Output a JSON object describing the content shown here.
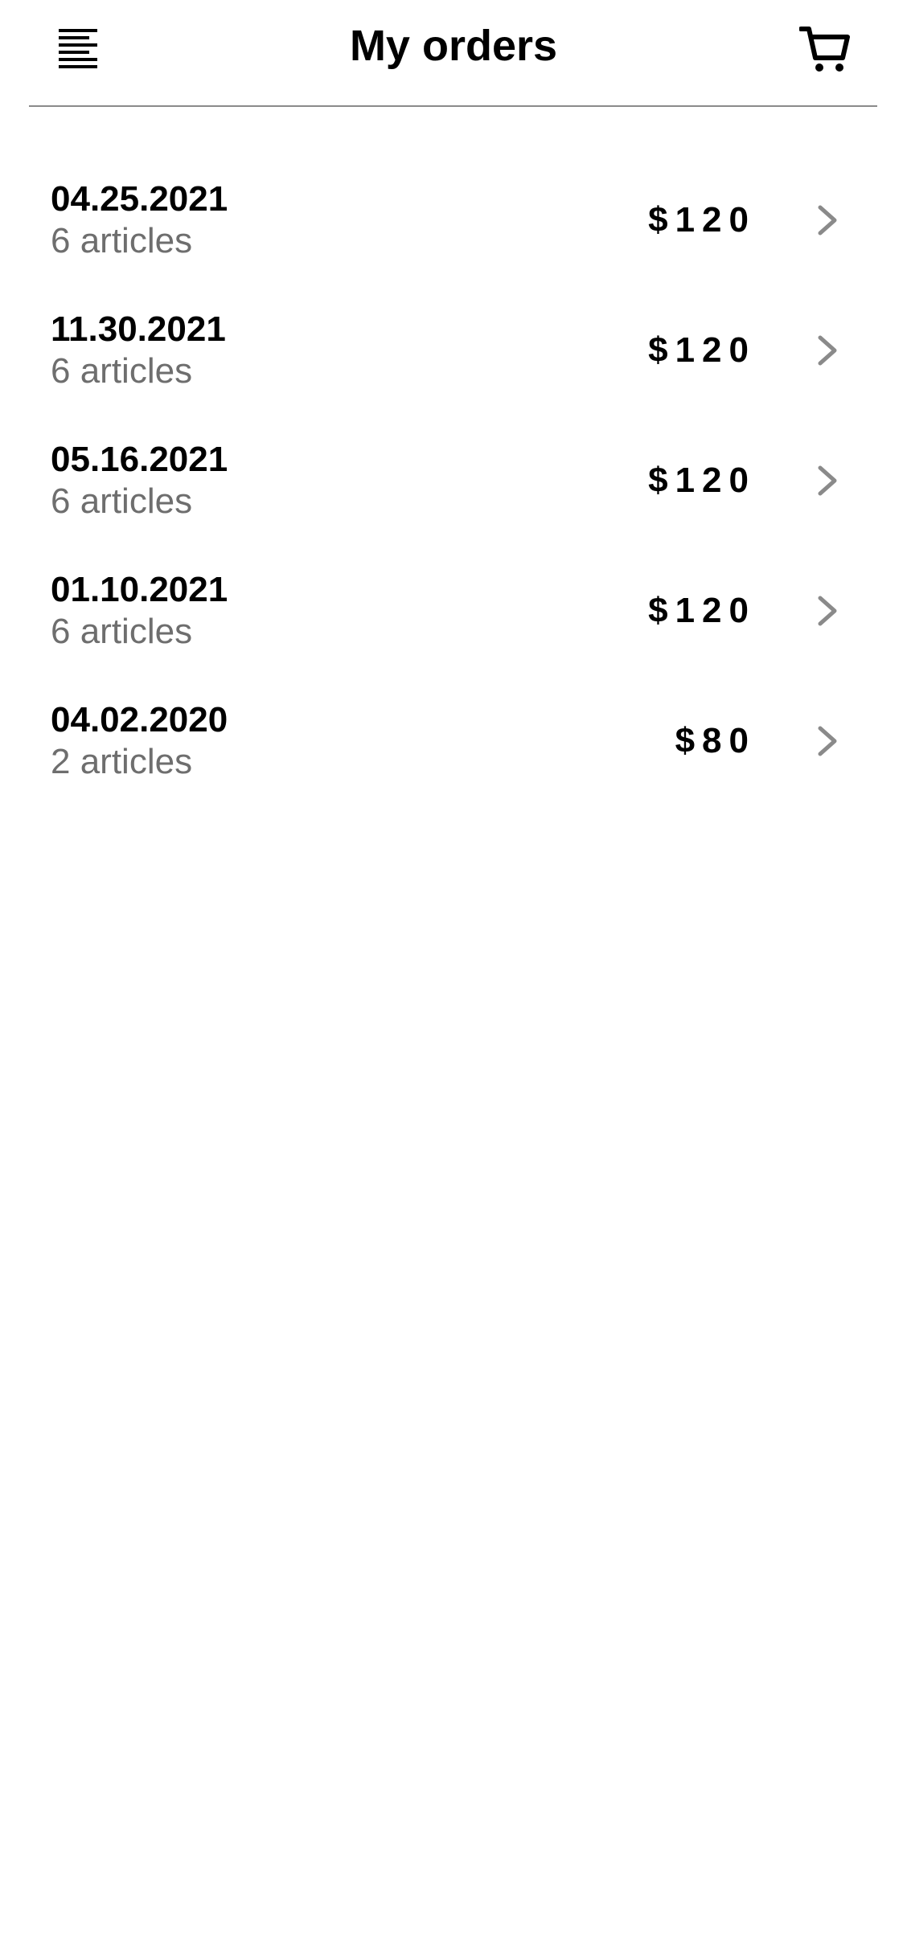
{
  "header": {
    "title": "My orders",
    "menu_icon": "menu-lines-icon",
    "cart_icon": "cart-icon"
  },
  "orders": [
    {
      "date": "04.25.2021",
      "articles": "6 articles",
      "price": "$120"
    },
    {
      "date": "11.30.2021",
      "articles": "6 articles",
      "price": "$120"
    },
    {
      "date": "05.16.2021",
      "articles": "6 articles",
      "price": "$120"
    },
    {
      "date": "01.10.2021",
      "articles": "6 articles",
      "price": "$120"
    },
    {
      "date": "04.02.2020",
      "articles": "2 articles",
      "price": "$80"
    }
  ],
  "colors": {
    "text_primary": "#000000",
    "text_secondary": "#6e6e6e",
    "divider": "#8a8a8a",
    "chevron": "#8a8a8a"
  }
}
